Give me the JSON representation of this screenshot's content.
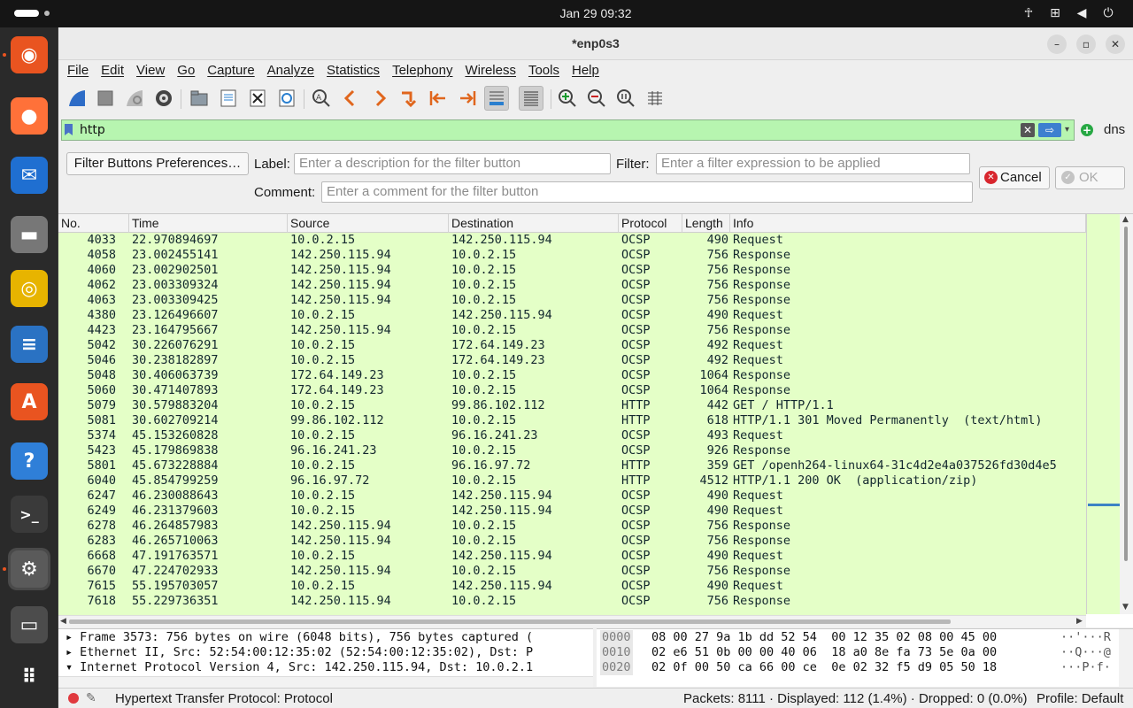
{
  "system": {
    "clock": "Jan 29  09:32",
    "tray_icons": [
      "accessibility-icon",
      "network-icon",
      "volume-icon",
      "power-icon"
    ]
  },
  "dock": {
    "items": [
      {
        "name": "ubuntu-installer",
        "color": "#e95420",
        "glyph": "◉"
      },
      {
        "name": "firefox",
        "color": "#ff7139",
        "glyph": "●"
      },
      {
        "name": "thunderbird",
        "color": "#1f6fd1",
        "glyph": "✉"
      },
      {
        "name": "files",
        "color": "#777777",
        "glyph": "▬"
      },
      {
        "name": "rhythmbox",
        "color": "#e7b400",
        "glyph": "◎"
      },
      {
        "name": "libreoffice-writer",
        "color": "#2a72c3",
        "glyph": "≡"
      },
      {
        "name": "app-center",
        "color": "#e95420",
        "glyph": "A"
      },
      {
        "name": "help",
        "color": "#2f7fd8",
        "glyph": "?"
      },
      {
        "name": "terminal",
        "color": "#3a3a3a",
        "glyph": ">_"
      },
      {
        "name": "settings",
        "color": "#5a5a5a",
        "glyph": "⚙"
      },
      {
        "name": "disk",
        "color": "#4c4c4c",
        "glyph": "▭"
      },
      {
        "name": "show-apps",
        "color": "#2a2a2a",
        "glyph": "⠿"
      }
    ]
  },
  "window": {
    "title": "*enp0s3",
    "menu": [
      "File",
      "Edit",
      "View",
      "Go",
      "Capture",
      "Analyze",
      "Statistics",
      "Telephony",
      "Wireless",
      "Tools",
      "Help"
    ]
  },
  "filter": {
    "value": "http",
    "dns_button": "dns"
  },
  "filter_buttons": {
    "prefs_button": "Filter Buttons Preferences…",
    "label_label": "Label:",
    "label_placeholder": "Enter a description for the filter button",
    "filter_label": "Filter:",
    "filter_placeholder": "Enter a filter expression to be applied",
    "comment_label": "Comment:",
    "comment_placeholder": "Enter a comment for the filter button",
    "cancel": "Cancel",
    "ok": "OK"
  },
  "packet_list": {
    "columns": [
      "No.",
      "Time",
      "Source",
      "Destination",
      "Protocol",
      "Length",
      "Info"
    ],
    "row_color": "#e4ffc7",
    "rows": [
      [
        "4033",
        "22.970894697",
        "10.0.2.15",
        "142.250.115.94",
        "OCSP",
        "490",
        "Request"
      ],
      [
        "4058",
        "23.002455141",
        "142.250.115.94",
        "10.0.2.15",
        "OCSP",
        "756",
        "Response"
      ],
      [
        "4060",
        "23.002902501",
        "142.250.115.94",
        "10.0.2.15",
        "OCSP",
        "756",
        "Response"
      ],
      [
        "4062",
        "23.003309324",
        "142.250.115.94",
        "10.0.2.15",
        "OCSP",
        "756",
        "Response"
      ],
      [
        "4063",
        "23.003309425",
        "142.250.115.94",
        "10.0.2.15",
        "OCSP",
        "756",
        "Response"
      ],
      [
        "4380",
        "23.126496607",
        "10.0.2.15",
        "142.250.115.94",
        "OCSP",
        "490",
        "Request"
      ],
      [
        "4423",
        "23.164795667",
        "142.250.115.94",
        "10.0.2.15",
        "OCSP",
        "756",
        "Response"
      ],
      [
        "5042",
        "30.226076291",
        "10.0.2.15",
        "172.64.149.23",
        "OCSP",
        "492",
        "Request"
      ],
      [
        "5046",
        "30.238182897",
        "10.0.2.15",
        "172.64.149.23",
        "OCSP",
        "492",
        "Request"
      ],
      [
        "5048",
        "30.406063739",
        "172.64.149.23",
        "10.0.2.15",
        "OCSP",
        "1064",
        "Response"
      ],
      [
        "5060",
        "30.471407893",
        "172.64.149.23",
        "10.0.2.15",
        "OCSP",
        "1064",
        "Response"
      ],
      [
        "5079",
        "30.579883204",
        "10.0.2.15",
        "99.86.102.112",
        "HTTP",
        "442",
        "GET / HTTP/1.1"
      ],
      [
        "5081",
        "30.602709214",
        "99.86.102.112",
        "10.0.2.15",
        "HTTP",
        "618",
        "HTTP/1.1 301 Moved Permanently  (text/html)"
      ],
      [
        "5374",
        "45.153260828",
        "10.0.2.15",
        "96.16.241.23",
        "OCSP",
        "493",
        "Request"
      ],
      [
        "5423",
        "45.179869838",
        "96.16.241.23",
        "10.0.2.15",
        "OCSP",
        "926",
        "Response"
      ],
      [
        "5801",
        "45.673228884",
        "10.0.2.15",
        "96.16.97.72",
        "HTTP",
        "359",
        "GET /openh264-linux64-31c4d2e4a037526fd30d4e5"
      ],
      [
        "6040",
        "45.854799259",
        "96.16.97.72",
        "10.0.2.15",
        "HTTP",
        "4512",
        "HTTP/1.1 200 OK  (application/zip)"
      ],
      [
        "6247",
        "46.230088643",
        "10.0.2.15",
        "142.250.115.94",
        "OCSP",
        "490",
        "Request"
      ],
      [
        "6249",
        "46.231379603",
        "10.0.2.15",
        "142.250.115.94",
        "OCSP",
        "490",
        "Request"
      ],
      [
        "6278",
        "46.264857983",
        "142.250.115.94",
        "10.0.2.15",
        "OCSP",
        "756",
        "Response"
      ],
      [
        "6283",
        "46.265710063",
        "142.250.115.94",
        "10.0.2.15",
        "OCSP",
        "756",
        "Response"
      ],
      [
        "6668",
        "47.191763571",
        "10.0.2.15",
        "142.250.115.94",
        "OCSP",
        "490",
        "Request"
      ],
      [
        "6670",
        "47.224702933",
        "142.250.115.94",
        "10.0.2.15",
        "OCSP",
        "756",
        "Response"
      ],
      [
        "7615",
        "55.195703057",
        "10.0.2.15",
        "142.250.115.94",
        "OCSP",
        "490",
        "Request"
      ],
      [
        "7618",
        "55.229736351",
        "142.250.115.94",
        "10.0.2.15",
        "OCSP",
        "756",
        "Response"
      ]
    ]
  },
  "details": [
    {
      "expander": "▸",
      "text": "Frame 3573: 756 bytes on wire (6048 bits), 756 bytes captured ("
    },
    {
      "expander": "▸",
      "text": "Ethernet II, Src: 52:54:00:12:35:02 (52:54:00:12:35:02), Dst: P"
    },
    {
      "expander": "▾",
      "text": "Internet Protocol Version 4, Src: 142.250.115.94, Dst: 10.0.2.1"
    }
  ],
  "hex": [
    {
      "offset": "0000",
      "bytes": "08 00 27 9a 1b dd 52 54  00 12 35 02 08 00 45 00",
      "ascii": "··'···R"
    },
    {
      "offset": "0010",
      "bytes": "02 e6 51 0b 00 00 40 06  18 a0 8e fa 73 5e 0a 00",
      "ascii": "··Q···@"
    },
    {
      "offset": "0020",
      "bytes": "02 0f 00 50 ca 66 00 ce  0e 02 32 f5 d9 05 50 18",
      "ascii": "···P·f·"
    }
  ],
  "status": {
    "field": "Hypertext Transfer Protocol: Protocol",
    "packets": "Packets: 8111 · Displayed: 112 (1.4%) · Dropped: 0 (0.0%)",
    "profile": "Profile: Default"
  }
}
